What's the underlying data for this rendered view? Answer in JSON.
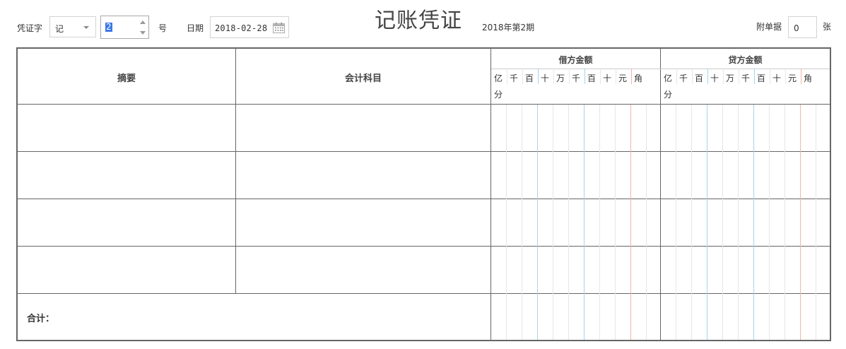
{
  "toolbar": {
    "voucher_word_label": "凭证字",
    "voucher_word_value": "记",
    "number_value": "2",
    "number_suffix": "号",
    "date_label": "日期",
    "date_value": "2018-02-28",
    "title": "记账凭证",
    "period": "2018年第2期",
    "attach_label": "附单据",
    "attach_count": "0",
    "attach_unit": "张"
  },
  "table": {
    "col_summary": "摘要",
    "col_account": "会计科目",
    "debit_header": "借方金额",
    "credit_header": "贷方金额",
    "units": [
      "亿",
      "千",
      "百",
      "十",
      "万",
      "千",
      "百",
      "十",
      "元",
      "角",
      "分"
    ],
    "total_label": "合计："
  },
  "colors": {
    "grid_line": "#e6e6e6",
    "grid_blue": "#a9d3ea",
    "grid_red": "#f1b7a6",
    "border": "#666666"
  }
}
